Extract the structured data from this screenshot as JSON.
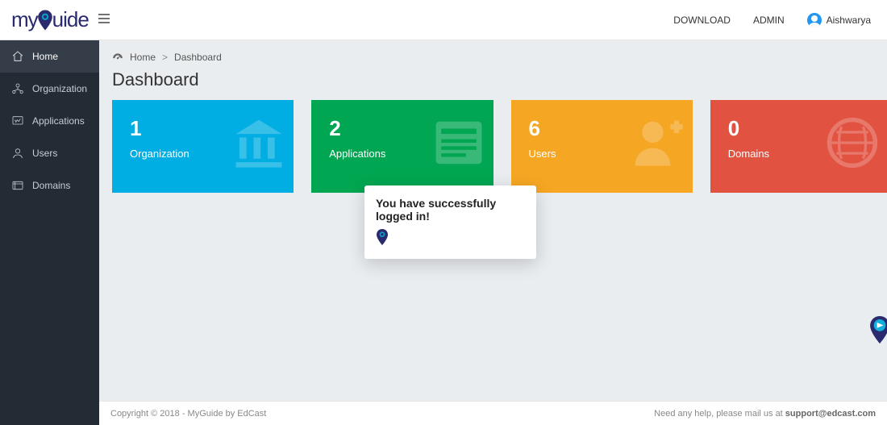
{
  "logo": {
    "brand_left": "m",
    "brand_mid": "y",
    "brand_right": "uide"
  },
  "header": {
    "links": {
      "download": "DOWNLOAD",
      "admin": "ADMIN"
    },
    "user_name": "Aishwarya"
  },
  "sidebar": {
    "items": [
      {
        "label": "Home"
      },
      {
        "label": "Organization"
      },
      {
        "label": "Applications"
      },
      {
        "label": "Users"
      },
      {
        "label": "Domains"
      }
    ]
  },
  "breadcrumb": {
    "home": "Home",
    "current": "Dashboard"
  },
  "page": {
    "title": "Dashboard"
  },
  "cards": {
    "org": {
      "count": "1",
      "label": "Organization"
    },
    "apps": {
      "count": "2",
      "label": "Applications"
    },
    "users": {
      "count": "6",
      "label": "Users"
    },
    "domains": {
      "count": "0",
      "label": "Domains"
    }
  },
  "toast": {
    "message": "You have successfully logged in!"
  },
  "footer": {
    "left": "Copyright © 2018 - MyGuide by EdCast",
    "right_a": "Need any help, please mail us at ",
    "right_mail": "support@edcast.com"
  }
}
